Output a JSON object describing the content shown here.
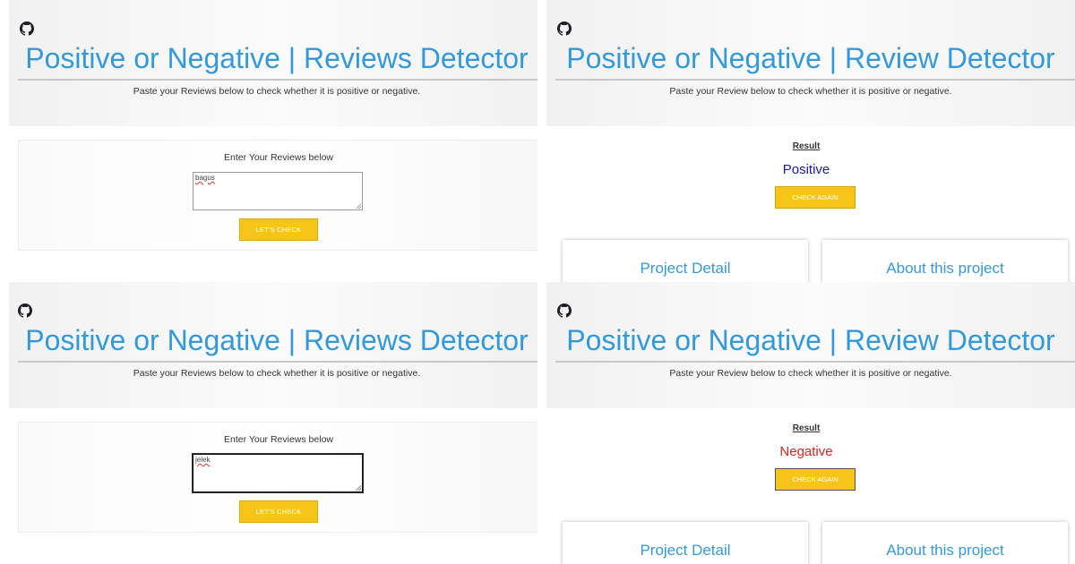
{
  "colors": {
    "accent": "#3399dd",
    "button": "#f7c51a",
    "positive": "#1a1aa8",
    "negative": "#dd2222"
  },
  "panels": [
    {
      "id": "top-left",
      "title": "Positive or Negative | Reviews Detector",
      "subtitle": "Paste your Reviews below to check whether it is positive or negative.",
      "form": {
        "label": "Enter Your Reviews below",
        "input_value": "bagus",
        "button": "LET'S CHECK"
      }
    },
    {
      "id": "top-right",
      "title": "Positive or Negative | Review Detector",
      "subtitle": "Paste your Review below to check whether it is positive or negative.",
      "result": {
        "label": "Result",
        "value": "Positive",
        "button": "CHECK AGAIN"
      },
      "cards": [
        "Project Detail",
        "About this project"
      ]
    },
    {
      "id": "bottom-left",
      "title": "Positive or Negative | Reviews Detector",
      "subtitle": "Paste your Reviews below to check whether it is positive or negative.",
      "form": {
        "label": "Enter Your Reviews below",
        "input_value": "jelek",
        "button": "LET'S CHECK"
      }
    },
    {
      "id": "bottom-right",
      "title": "Positive or Negative | Review Detector",
      "subtitle": "Paste your Review below to check whether it is positive or negative.",
      "result": {
        "label": "Result",
        "value": "Negative",
        "button": "CHECK AGAIN"
      },
      "cards": [
        "Project Detail",
        "About this project"
      ]
    }
  ],
  "icons": {
    "github": "github-icon"
  }
}
